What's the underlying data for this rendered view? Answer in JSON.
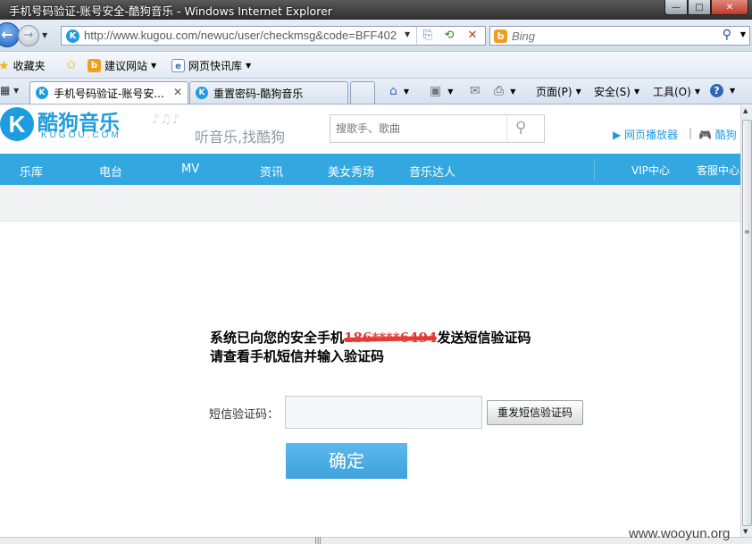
{
  "window": {
    "title": "手机号码验证-账号安全-酷狗音乐 - Windows Internet Explorer",
    "buttons": {
      "minimize": "—",
      "maximize": "□",
      "close": "✕"
    }
  },
  "nav": {
    "back_icon": "back-arrow-icon",
    "back_glyph": "←",
    "forward_glyph": "→",
    "url_host": "http://www.kugou.com",
    "url_path": "/newuc/user/checkmsg&code=BFF402",
    "search_placeholder": "Bing"
  },
  "favorites": {
    "label": "收藏夹",
    "items": [
      {
        "label": "建议网站",
        "icon": "bing-icon"
      },
      {
        "label": "网页快讯库",
        "icon": "webslice-icon"
      }
    ]
  },
  "tabs": [
    {
      "label": "手机号码验证-账号安...",
      "active": true
    },
    {
      "label": "重置密码-酷狗音乐",
      "active": false
    }
  ],
  "command_bar": {
    "items": [
      {
        "label": "页面(P)"
      },
      {
        "label": "安全(S)"
      },
      {
        "label": "工具(O)"
      }
    ]
  },
  "site": {
    "logo_letter": "K",
    "logo_text": "酷狗音乐",
    "logo_sub": "KUGOU.COM",
    "slogan": "听音乐,找酷狗",
    "search_placeholder": "搜歌手、歌曲",
    "header_links": [
      "网页播放器",
      "酷狗"
    ],
    "nav": [
      "乐库",
      "电台",
      "MV",
      "资讯",
      "美女秀场",
      "音乐达人",
      "VIP中心",
      "客服中心"
    ]
  },
  "verify": {
    "line1_prefix": "系统已向您的安全手机",
    "phone_masked": "186****6494",
    "line1_suffix": "发送短信验证码",
    "line2": "请查看手机短信并输入验证码",
    "code_label": "短信验证码：",
    "resend_button": "重发短信验证码",
    "confirm_button": "确定"
  },
  "watermark": "www.wooyun.org",
  "colors": {
    "brand_blue": "#1d9de0",
    "nav_blue": "#33a7e0",
    "button_blue": "#4eaee8",
    "redact_red": "#e03a3a"
  }
}
